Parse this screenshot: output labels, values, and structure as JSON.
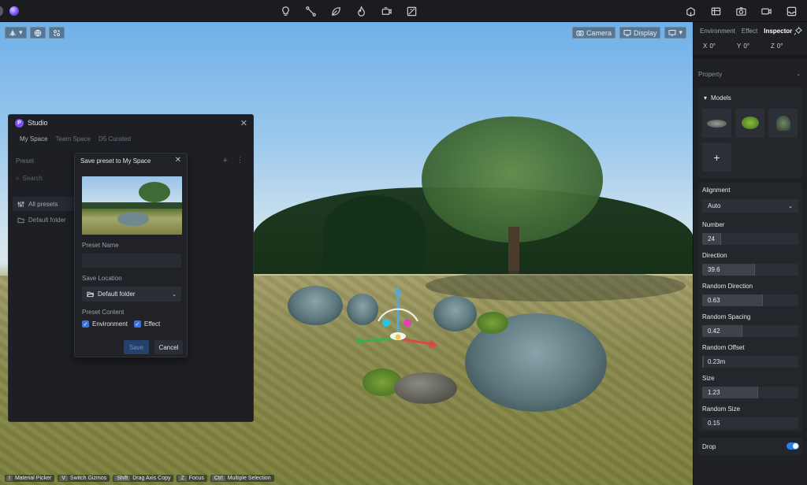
{
  "topbar": {
    "center_icons": [
      "light-icon",
      "path-icon",
      "leaf-icon",
      "fire-icon",
      "camera-rig-icon",
      "image-slash-icon"
    ],
    "right_icons": [
      "asset-library-icon",
      "render-farm-icon",
      "photo-camera-icon",
      "video-camera-icon",
      "inbox-icon"
    ]
  },
  "viewport": {
    "camera_label": "Camera",
    "display_label": "Display",
    "shortcuts": [
      {
        "key": "I",
        "label": "Material Picker"
      },
      {
        "key": "V",
        "label": "Switch Gizmos"
      },
      {
        "key": "Shift",
        "label": "Drag Axis Copy"
      },
      {
        "key": "Z",
        "label": "Focus"
      },
      {
        "key": "Ctrl",
        "label": "Multiple Selection"
      }
    ]
  },
  "studio": {
    "title": "Studio",
    "tabs": [
      "My Space",
      "Team Space",
      "D5 Curated"
    ],
    "preset_label": "Preset",
    "search_placeholder": "Search",
    "nav": [
      "All presets",
      "Default folder"
    ]
  },
  "dialog": {
    "title": "Save preset to My Space",
    "preset_name_label": "Preset Name",
    "preset_name_value": "",
    "save_location_label": "Save Location",
    "save_location_value": "Default folder",
    "preset_content_label": "Preset Content",
    "checks": [
      "Environment",
      "Effect"
    ],
    "save_label": "Save",
    "cancel_label": "Cancel"
  },
  "panel": {
    "tabs": [
      "Environment",
      "Effect",
      "Inspector"
    ],
    "coords": [
      {
        "axis": "X",
        "value": "0°"
      },
      {
        "axis": "Y",
        "value": "0°"
      },
      {
        "axis": "Z",
        "value": "0°"
      }
    ],
    "property_label": "Property",
    "models_label": "Models",
    "alignment_label": "Alignment",
    "alignment_value": "Auto",
    "params": [
      {
        "label": "Number",
        "value": "24",
        "fill": 0.2
      },
      {
        "label": "Direction",
        "value": "39.6",
        "fill": 0.55
      },
      {
        "label": "Random Direction",
        "value": "0.63",
        "fill": 0.63
      },
      {
        "label": "Random Spacing",
        "value": "0.42",
        "fill": 0.42
      },
      {
        "label": "Random Offset",
        "value": "0.23m",
        "fill": 0.02
      },
      {
        "label": "Size",
        "value": "1.23",
        "fill": 0.58
      },
      {
        "label": "Random Size",
        "value": "0.15",
        "fill": 0.0
      }
    ],
    "drop_label": "Drop",
    "drop_on": true
  }
}
